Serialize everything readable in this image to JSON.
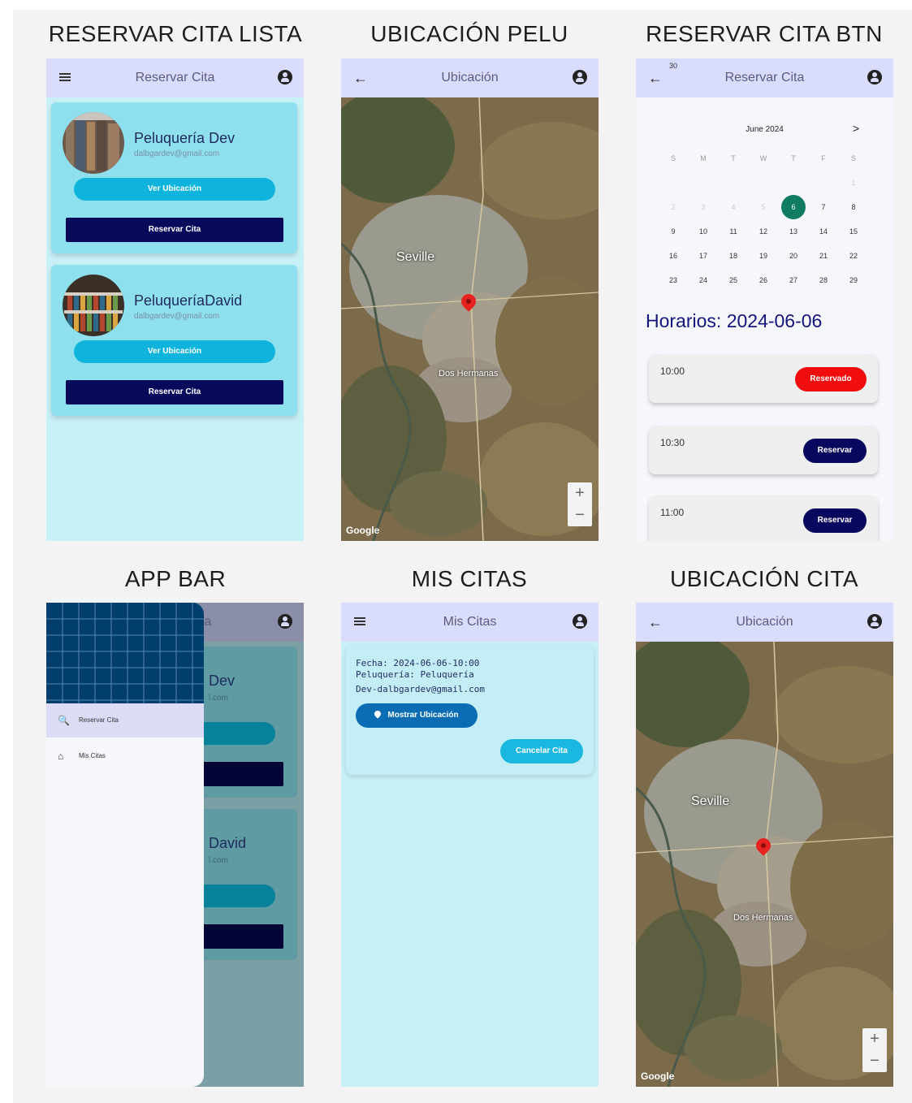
{
  "captions": {
    "c1": "RESERVAR CITA LISTA",
    "c2": "UBICACIÓN PELU",
    "c3": "RESERVAR CITA BTN",
    "c4": "APP BAR",
    "c5": "MIS CITAS",
    "c6": "UBICACIÓN CITA"
  },
  "screen1": {
    "title": "Reservar Cita",
    "cards": [
      {
        "name": "Peluquería Dev",
        "email": "dalbgardev@gmail.com",
        "ubicacion_label": "Ver Ubicación",
        "reservar_label": "Reservar Cita"
      },
      {
        "name": "PeluqueríaDavid",
        "email": "dalbgardev@gmail.com",
        "ubicacion_label": "Ver Ubicación",
        "reservar_label": "Reservar Cita"
      }
    ]
  },
  "screen2": {
    "title": "Ubicación",
    "city": "Seville",
    "town": "Dos Hermanas",
    "google": "Google",
    "zoom_in": "+",
    "zoom_out": "−"
  },
  "screen3": {
    "title": "Reservar Cita",
    "month": "June 2024",
    "next": ">",
    "weekdays": [
      "S",
      "M",
      "T",
      "W",
      "T",
      "F",
      "S"
    ],
    "selected_day": "6",
    "horarios": "Horarios: 2024-06-06",
    "slots": [
      {
        "time": "10:00",
        "status": "Reservado",
        "color": "#f10d0d"
      },
      {
        "time": "10:30",
        "status": "Reservar",
        "color": "#08085e"
      },
      {
        "time": "11:00",
        "status": "Reservar",
        "color": "#08085e"
      }
    ]
  },
  "screen4": {
    "title_fragment": "ta",
    "card_fragments": [
      "Dev",
      "l.com",
      "David",
      "l.com"
    ],
    "menu": [
      {
        "icon": "search-icon",
        "label": "Reservar Cita"
      },
      {
        "icon": "home-icon",
        "label": "Mis Citas"
      }
    ]
  },
  "screen5": {
    "title": "Mis Citas",
    "fecha": "Fecha: 2024-06-06-10:00",
    "peluqueria": "Peluquería: Peluquería",
    "contacto": "Dev-dalbgardev@gmail.com",
    "mostrar_label": "Mostrar Ubicación",
    "cancelar_label": "Cancelar Cita"
  },
  "screen6": {
    "title": "Ubicación",
    "city": "Seville",
    "town": "Dos Hermanas",
    "google": "Google",
    "zoom_in": "+",
    "zoom_out": "−"
  },
  "colors": {
    "appbar": "#d9dcfd",
    "page": "#c8f0f7",
    "card": "#8ee0ef",
    "primary_button": "#07095b",
    "secondary_button": "#0fb4dc",
    "selected_day": "#0f7b63",
    "reserved": "#f10d0d",
    "drawer_header": "#003e6e"
  }
}
